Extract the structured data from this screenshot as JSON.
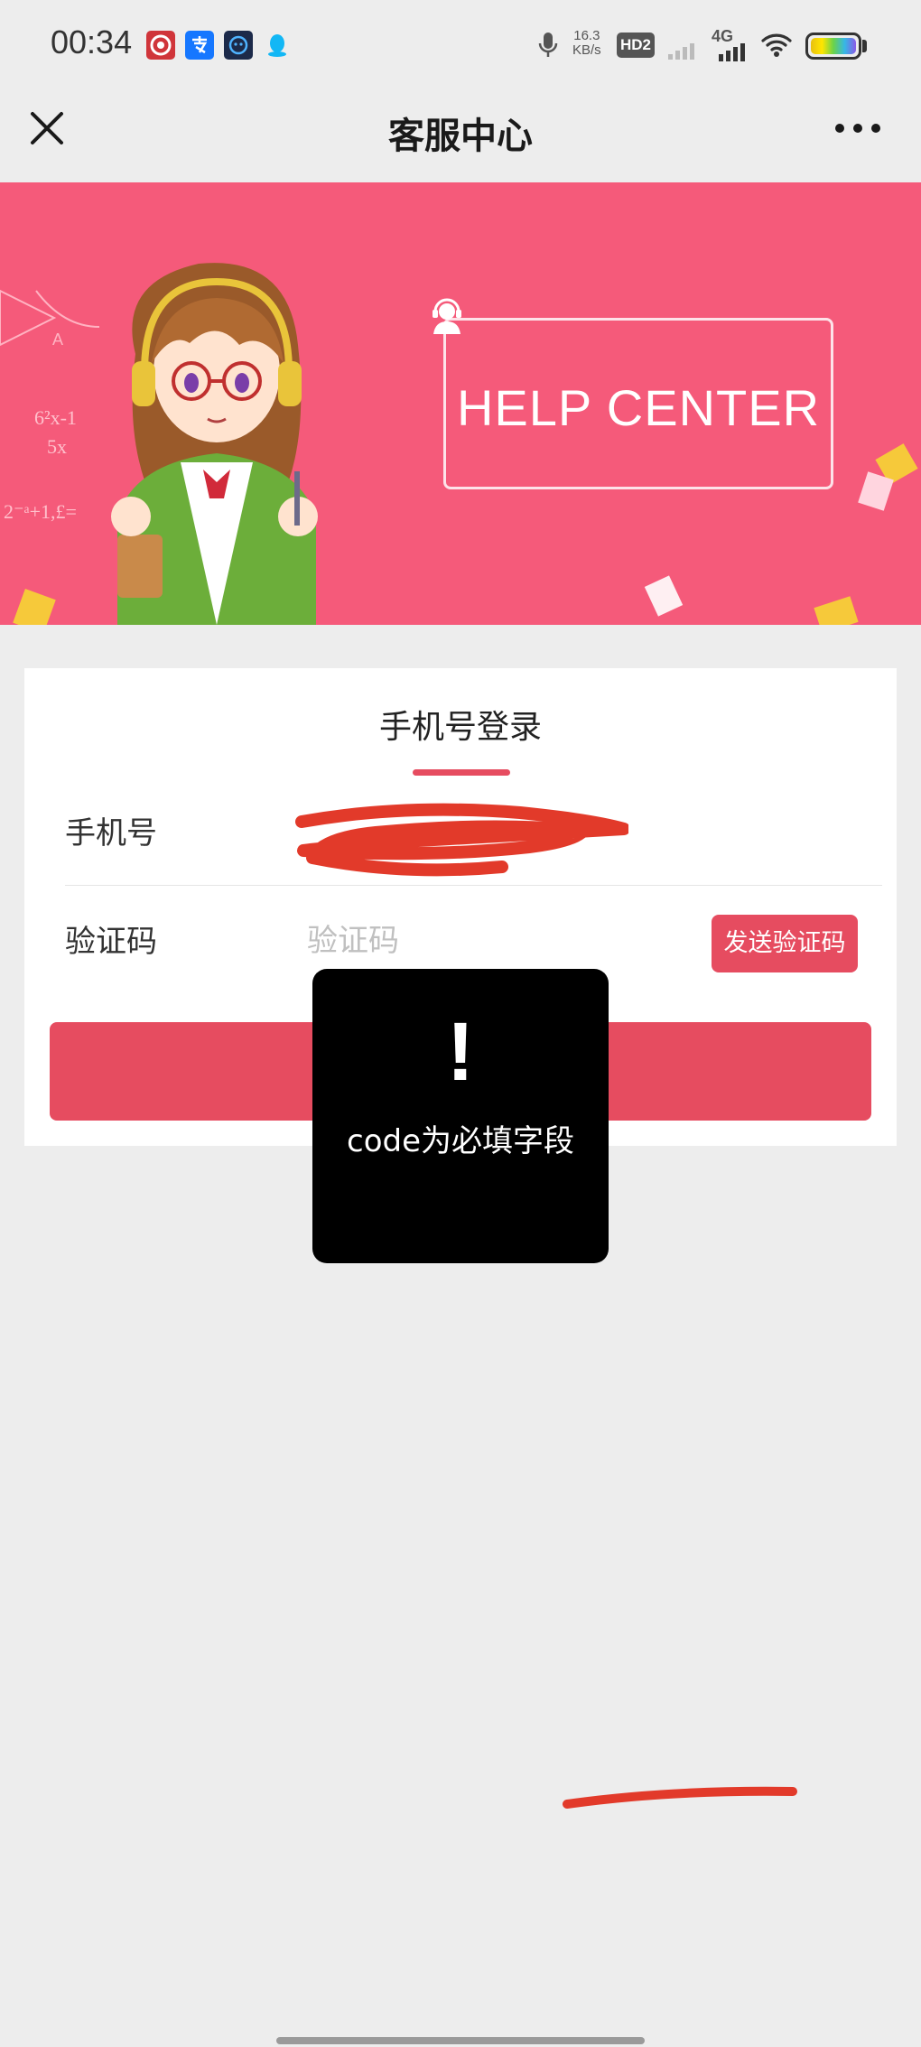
{
  "status_bar": {
    "time": "00:34",
    "net_speed_value": "16.3",
    "net_speed_unit": "KB/s",
    "hd_badge": "HD2",
    "signal_label": "4G",
    "battery_colors": [
      "#e8c010",
      "#6ad24a",
      "#36b7e6",
      "#8a5ae8"
    ],
    "app_icons": [
      "target-app-icon",
      "alipay-icon",
      "smart-app-icon",
      "qq-icon"
    ]
  },
  "nav": {
    "title": "客服中心",
    "close_icon": "close-icon",
    "more_icon": "more-icon"
  },
  "banner": {
    "title": "HELP CENTER",
    "background_color": "#f55a7a",
    "formula_1": "6²x-1",
    "formula_2": "5x",
    "formula_3": "2⁻ᵃ+1,£="
  },
  "login": {
    "title": "手机号登录",
    "accent_color": "#e64c60",
    "phone_label": "手机号",
    "code_label": "验证码",
    "code_placeholder": "验证码",
    "send_code_button": "发送验证码",
    "submit_label": ""
  },
  "toast": {
    "icon": "!",
    "message": "code为必填字段"
  }
}
